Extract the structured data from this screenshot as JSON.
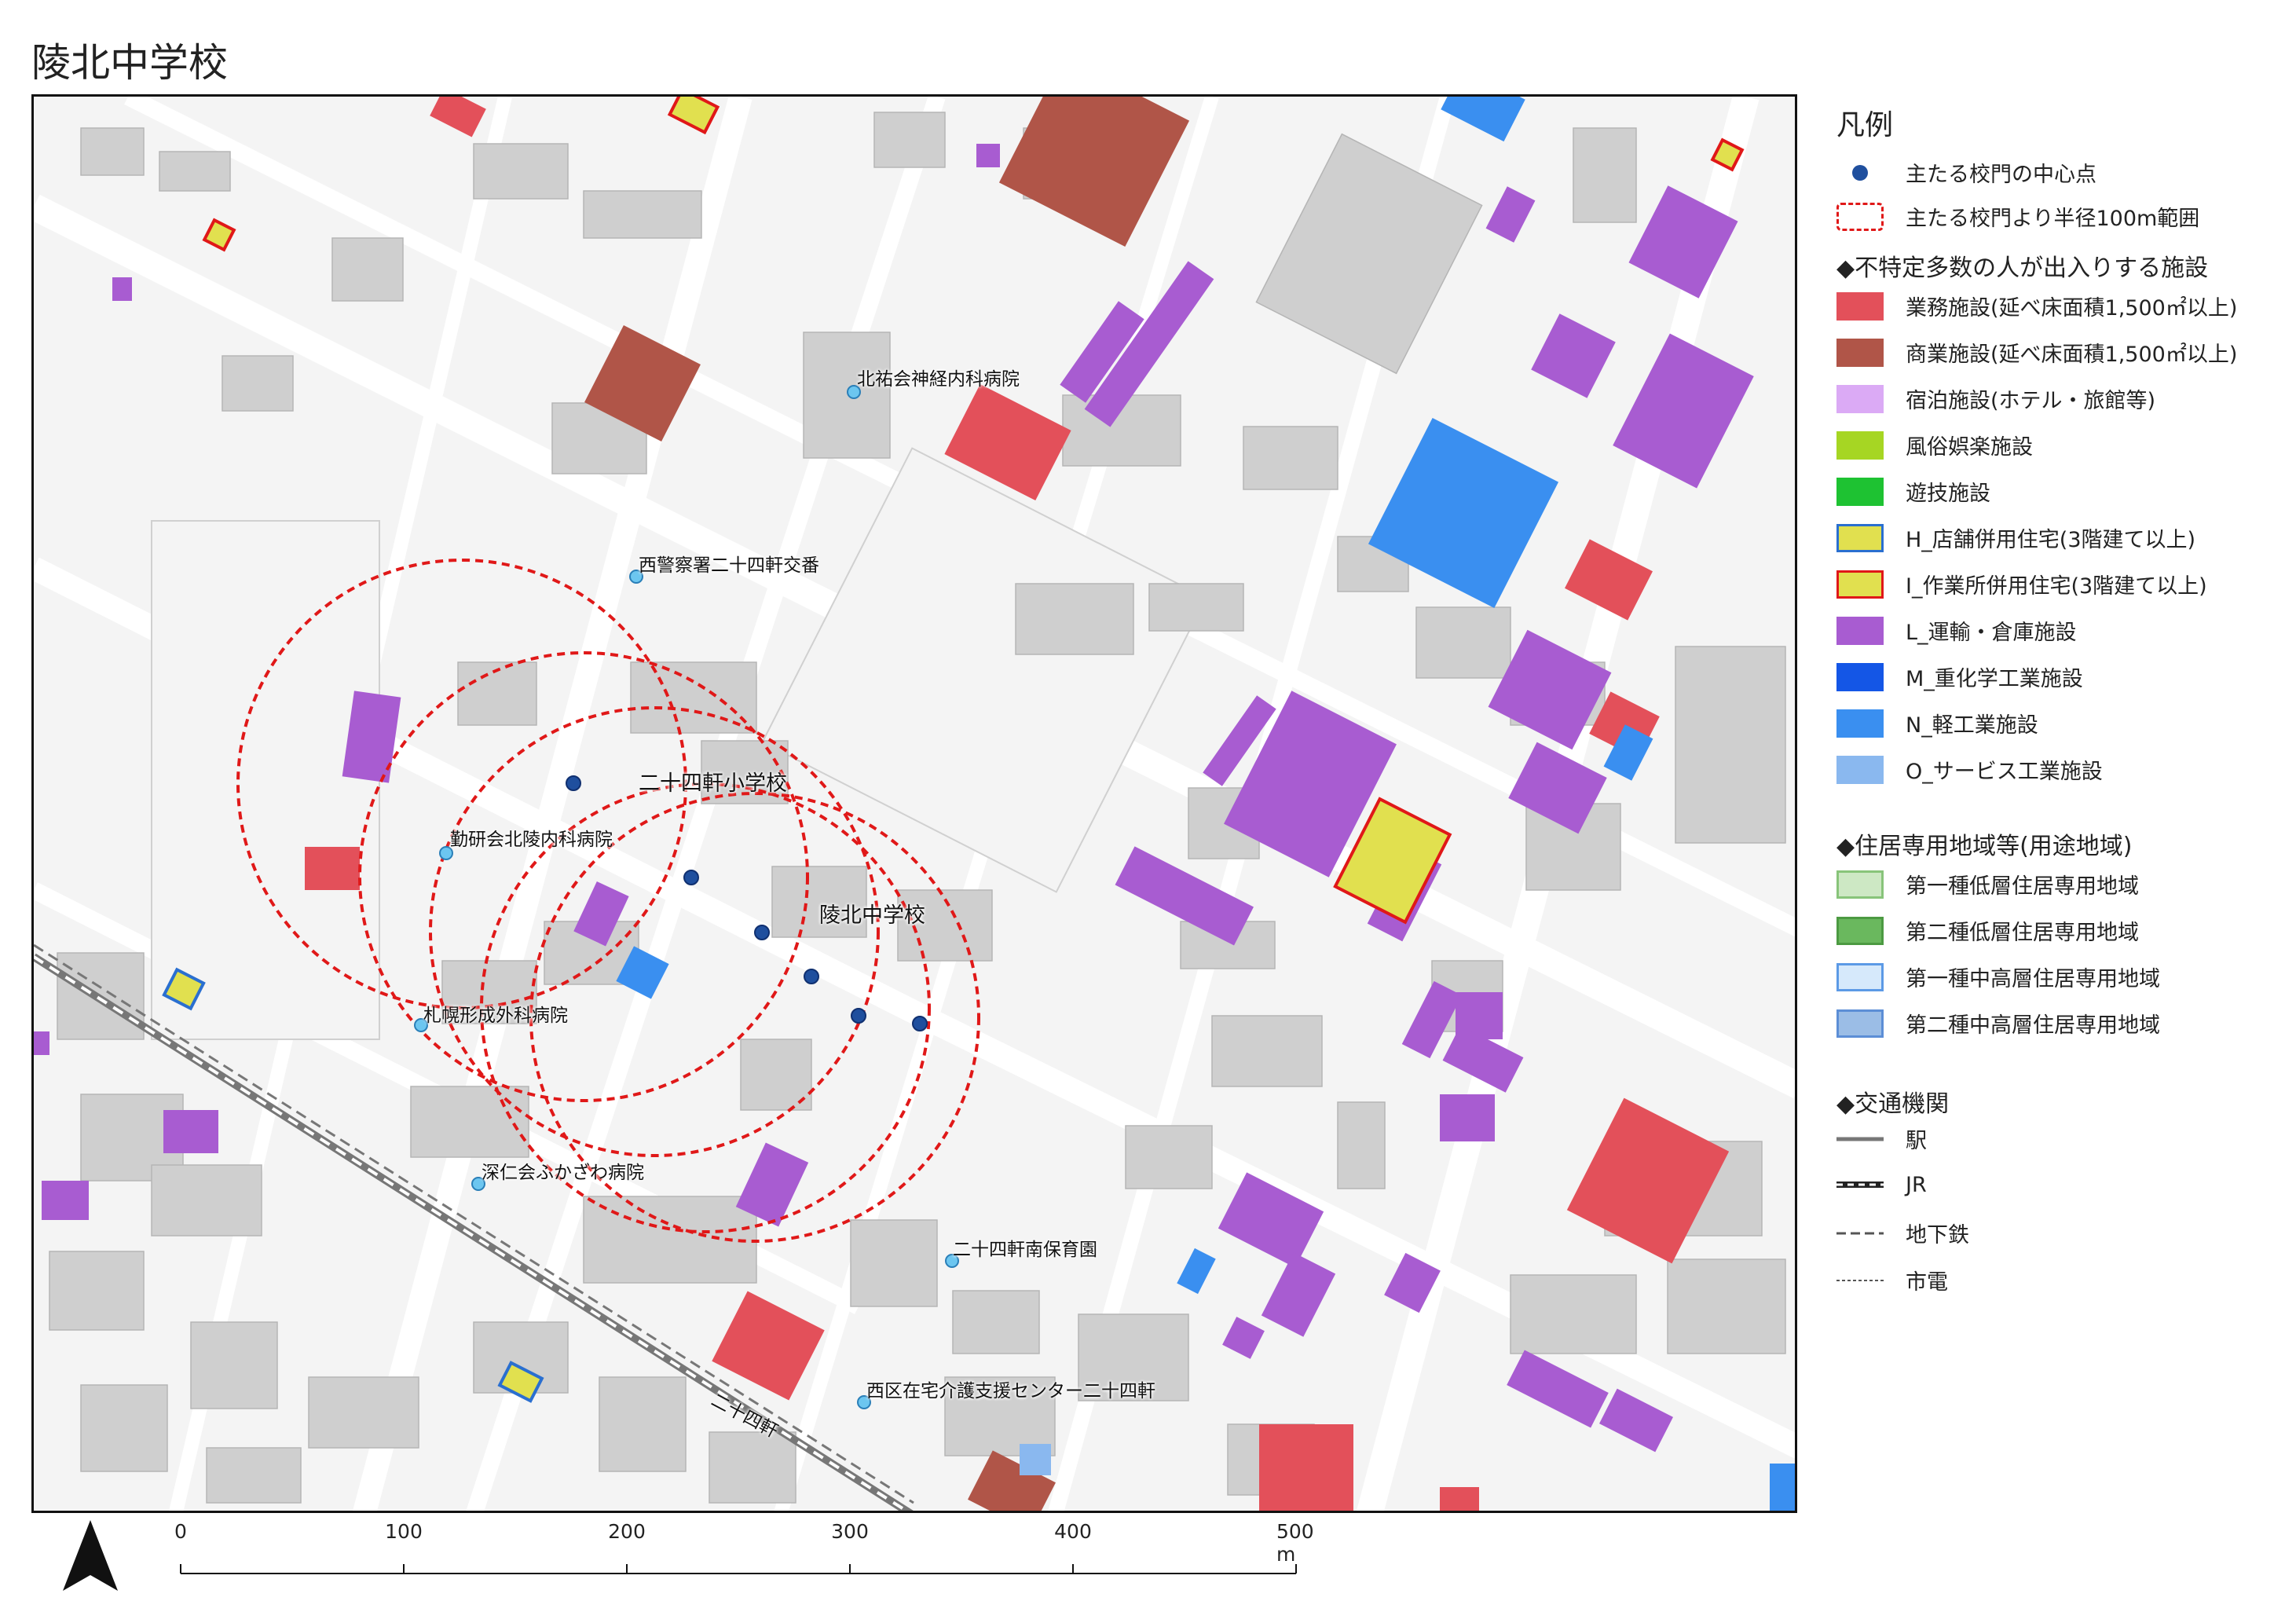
{
  "title": "陵北中学校",
  "map": {
    "labels": {
      "school_main": "陵北中学校",
      "school_elem": "二十四軒小学校",
      "hospital_neuro": "北祐会神経内科病院",
      "police_box": "西警察署二十四軒交番",
      "hospital_ryoko": "勤研会北陵内科病院",
      "hospital_ortho": "札幌形成外科病院",
      "hospital_fukazawa": "深仁会ふかざわ病院",
      "nursery": "二十四軒南保育園",
      "care_center": "西区在宅介護支援センター二十四軒",
      "station": "二十四軒"
    },
    "colors": {
      "business": "#e3505a",
      "commercial": "#b05548",
      "transport": "#a85cd1",
      "light_industry": "#3a8ff0",
      "service_industry": "#8ab8ef",
      "shop_housing_fill": "#e1e04f",
      "shop_housing_border": "#2a6fd0",
      "work_housing_border": "#e01818",
      "building": "#cfcfcf",
      "road": "#ffffff",
      "radius": "#e01818",
      "gate": "#1f4f9e"
    },
    "gate_points": 7,
    "radius_circles": 5
  },
  "legend": {
    "heading": "凡例",
    "gate_center": "主たる校門の中心点",
    "radius_range": "主たる校門より半径100m範囲",
    "section_public": "◆不特定多数の人が出入りする施設",
    "items_public": [
      {
        "label": "業務施設(延べ床面積1,500㎡以上)",
        "fill": "#e3505a",
        "border": "#e3505a"
      },
      {
        "label": "商業施設(延べ床面積1,500㎡以上)",
        "fill": "#b05548",
        "border": "#b05548"
      },
      {
        "label": "宿泊施設(ホテル・旅館等)",
        "fill": "#dbaaf5",
        "border": "#dbaaf5"
      },
      {
        "label": "風俗娯楽施設",
        "fill": "#a6d623",
        "border": "#a6d623"
      },
      {
        "label": "遊技施設",
        "fill": "#1ec232",
        "border": "#1ec232"
      },
      {
        "label": "H_店舗併用住宅(3階建て以上)",
        "fill": "#e1e04f",
        "border": "#2a6fd0"
      },
      {
        "label": "I_作業所併用住宅(3階建て以上)",
        "fill": "#e1e04f",
        "border": "#e01818"
      },
      {
        "label": "L_運輸・倉庫施設",
        "fill": "#a85cd1",
        "border": "#a85cd1"
      },
      {
        "label": "M_重化学工業施設",
        "fill": "#1456e6",
        "border": "#1456e6"
      },
      {
        "label": "N_軽工業施設",
        "fill": "#3a8ff0",
        "border": "#3a8ff0"
      },
      {
        "label": "O_サービス工業施設",
        "fill": "#8ab8ef",
        "border": "#8ab8ef"
      }
    ],
    "section_zone": "◆住居専用地域等(用途地域)",
    "items_zone": [
      {
        "label": "第一種低層住居専用地域",
        "fill": "#cde8c4",
        "border": "#88c47a"
      },
      {
        "label": "第二種低層住居専用地域",
        "fill": "#6ab85e",
        "border": "#4c9a42"
      },
      {
        "label": "第一種中高層住居専用地域",
        "fill": "#d6e9fb",
        "border": "#5c9ae6"
      },
      {
        "label": "第二種中高層住居専用地域",
        "fill": "#9bbde6",
        "border": "#5c8ed6"
      }
    ],
    "section_transport": "◆交通機関",
    "items_transport": [
      {
        "label": "駅",
        "style": "solid"
      },
      {
        "label": "JR",
        "style": "rail"
      },
      {
        "label": "地下鉄",
        "style": "dash"
      },
      {
        "label": "市電",
        "style": "dot"
      }
    ]
  },
  "scale": {
    "ticks": [
      "0",
      "100",
      "200",
      "300",
      "400",
      "500 m"
    ]
  }
}
